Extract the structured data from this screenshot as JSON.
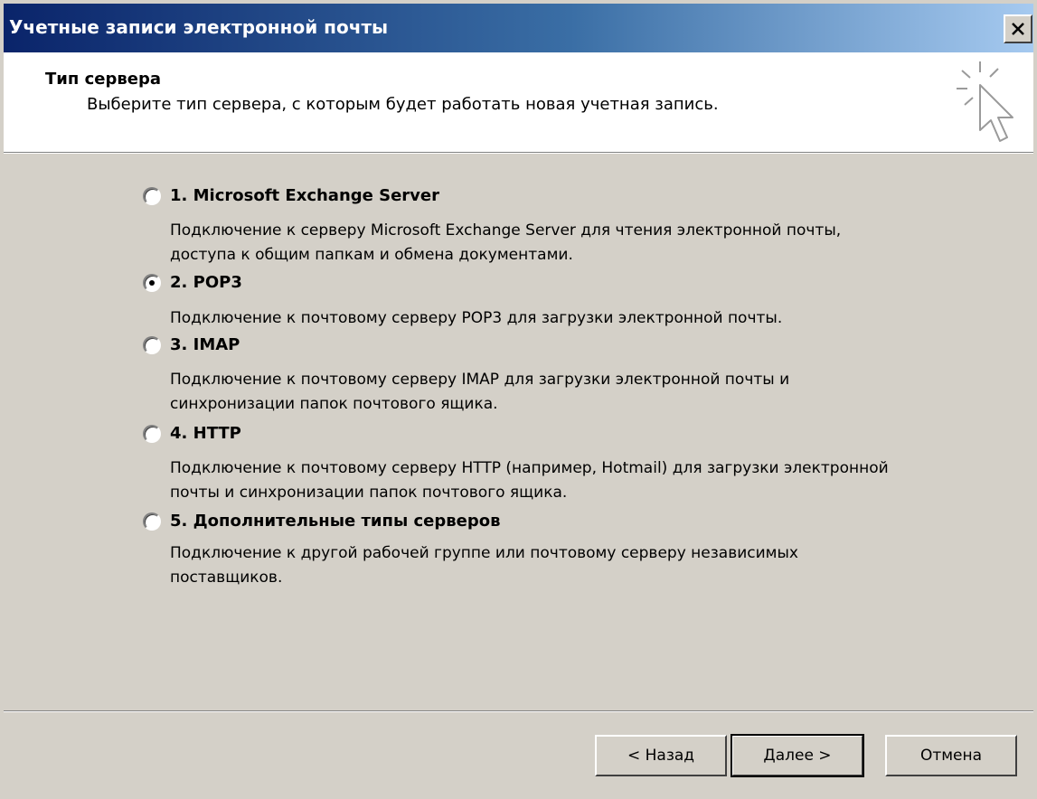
{
  "window": {
    "title": "Учетные записи электронной почты",
    "close_icon": "close-icon"
  },
  "header": {
    "title": "Тип сервера",
    "subtitle": "Выберите тип сервера, с которым будет работать новая учетная запись.",
    "icon": "wizard-cursor-icon"
  },
  "options": [
    {
      "label": "1. Microsoft Exchange Server",
      "description": "Подключение к серверу Microsoft Exchange Server для чтения электронной почты, доступа к общим папкам и обмена документами.",
      "checked": false
    },
    {
      "label": "2. POP3",
      "description": "Подключение к почтовому серверу POP3 для загрузки электронной почты.",
      "checked": true
    },
    {
      "label": "3. IMAP",
      "description": "Подключение к почтовому серверу IMAP для загрузки электронной почты и синхронизации папок почтового ящика.",
      "checked": false
    },
    {
      "label": "4. HTTP",
      "description": "Подключение к почтовому серверу HTTP (например, Hotmail) для загрузки электронной почты и синхронизации папок почтового ящика.",
      "checked": false
    },
    {
      "label": "5. Дополнительные типы серверов",
      "description": "Подключение к другой рабочей группе или почтовому серверу независимых поставщиков.",
      "checked": false
    }
  ],
  "buttons": {
    "back_label": "< Назад",
    "next_label": "Далее >",
    "cancel_label": "Отмена"
  }
}
